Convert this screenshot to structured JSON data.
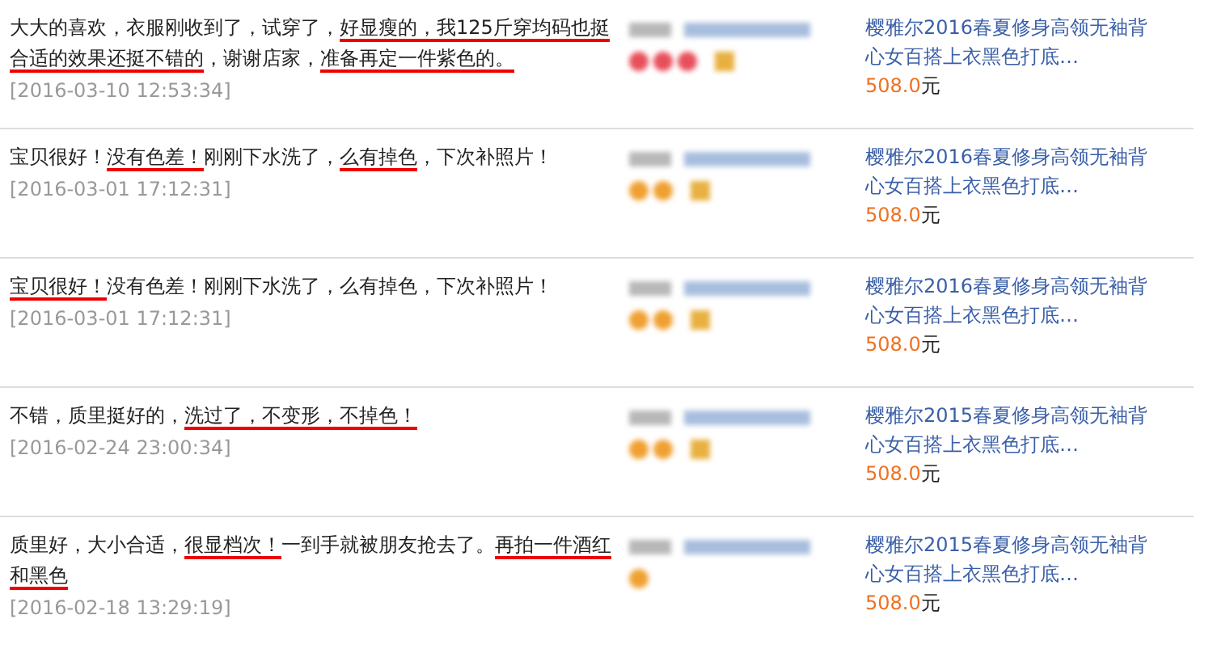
{
  "reviews": [
    {
      "comment": [
        {
          "text": "大大的喜欢，衣服刚收到了，试穿了，",
          "underlined": false
        },
        {
          "text": "好显瘦的，我125斤穿均码也挺合适的效果还挺不错的",
          "underlined": true
        },
        {
          "text": "，谢谢店家，",
          "underlined": false
        },
        {
          "text": "准备再定一件紫色的。",
          "underlined": true
        }
      ],
      "date": "[2016-03-10 12:53:34]",
      "rank_icons": [
        {
          "kind": "heart"
        },
        {
          "kind": "heart"
        },
        {
          "kind": "heart"
        }
      ],
      "verified": true,
      "product": {
        "title": "樱雅尔2016春夏修身高领无袖背心女百搭上衣黑色打底…",
        "price": "508.0",
        "unit": "元"
      }
    },
    {
      "comment": [
        {
          "text": "宝贝很好！",
          "underlined": false
        },
        {
          "text": "没有色差！",
          "underlined": true
        },
        {
          "text": "刚刚下水洗了，",
          "underlined": false
        },
        {
          "text": "么有掉色",
          "underlined": true
        },
        {
          "text": "，下次补照片！",
          "underlined": false
        }
      ],
      "date": "[2016-03-01 17:12:31]",
      "rank_icons": [
        {
          "kind": "diamond"
        },
        {
          "kind": "diamond"
        }
      ],
      "verified": true,
      "product": {
        "title": "樱雅尔2016春夏修身高领无袖背心女百搭上衣黑色打底…",
        "price": "508.0",
        "unit": "元"
      }
    },
    {
      "comment": [
        {
          "text": "宝贝很好！",
          "underlined": true
        },
        {
          "text": "没有色差！刚刚下水洗了，么有掉色，下次补照片！",
          "underlined": false
        }
      ],
      "date": "[2016-03-01 17:12:31]",
      "rank_icons": [
        {
          "kind": "diamond"
        },
        {
          "kind": "diamond"
        }
      ],
      "verified": true,
      "product": {
        "title": "樱雅尔2016春夏修身高领无袖背心女百搭上衣黑色打底…",
        "price": "508.0",
        "unit": "元"
      }
    },
    {
      "comment": [
        {
          "text": "不错，质里挺好的，",
          "underlined": false
        },
        {
          "text": "洗过了，不变形，不掉色！",
          "underlined": true
        }
      ],
      "date": "[2016-02-24 23:00:34]",
      "rank_icons": [
        {
          "kind": "diamond"
        },
        {
          "kind": "diamond"
        }
      ],
      "verified": true,
      "product": {
        "title": "樱雅尔2015春夏修身高领无袖背心女百搭上衣黑色打底…",
        "price": "508.0",
        "unit": "元"
      }
    },
    {
      "comment": [
        {
          "text": "质里好，大小合适，",
          "underlined": false
        },
        {
          "text": "很显档次！",
          "underlined": true
        },
        {
          "text": "一到手就被朋友抢去了。",
          "underlined": false
        },
        {
          "text": "再拍一件酒红和黑色",
          "underlined": true
        }
      ],
      "date": "[2016-02-18 13:29:19]",
      "rank_icons": [
        {
          "kind": "diamond"
        }
      ],
      "verified": false,
      "product": {
        "title": "樱雅尔2015春夏修身高领无袖背心女百搭上衣黑色打底…",
        "price": "508.0",
        "unit": "元"
      }
    }
  ]
}
